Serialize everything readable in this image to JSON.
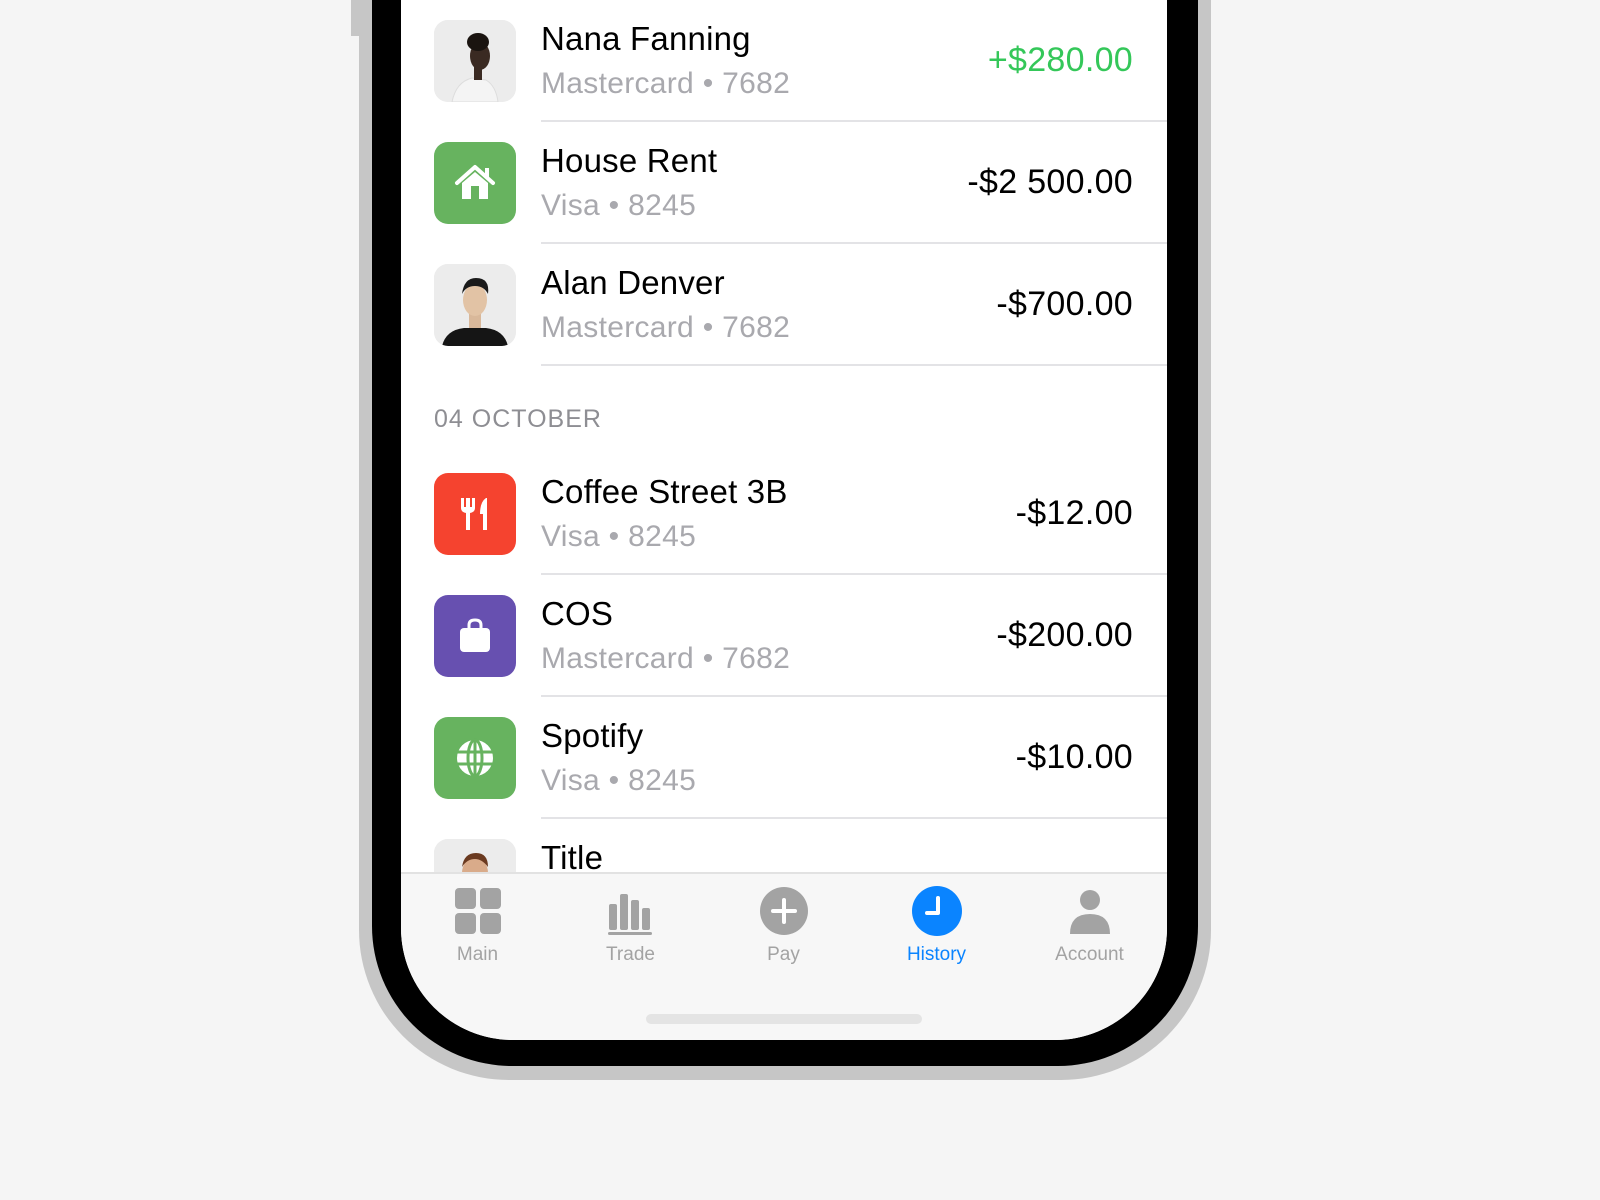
{
  "transactions_top": [
    {
      "name": "Nana Fanning",
      "card": "Mastercard",
      "last4": "7682",
      "amount": "+$280.00",
      "type": "income",
      "icon": "avatar-photo"
    },
    {
      "name": "House Rent",
      "card": "Visa",
      "last4": "8245",
      "amount": "-$2 500.00",
      "type": "expense",
      "icon": "house-icon",
      "icon_color": "#67b35f"
    },
    {
      "name": "Alan Denver",
      "card": "Mastercard",
      "last4": "7682",
      "amount": "-$700.00",
      "type": "expense",
      "icon": "avatar-photo"
    }
  ],
  "section_header": "04 OCTOBER",
  "transactions_bottom": [
    {
      "name": "Coffee Street 3B",
      "card": "Visa",
      "last4": "8245",
      "amount": "-$12.00",
      "type": "expense",
      "icon": "fork-knife-icon",
      "icon_color": "#f5432f"
    },
    {
      "name": "COS",
      "card": "Mastercard",
      "last4": "7682",
      "amount": "-$200.00",
      "type": "expense",
      "icon": "shopping-bag-icon",
      "icon_color": "#6750b0"
    },
    {
      "name": "Spotify",
      "card": "Visa",
      "last4": "8245",
      "amount": "-$10.00",
      "type": "expense",
      "icon": "globe-icon",
      "icon_color": "#67b35f"
    },
    {
      "name": "Title",
      "icon": "avatar-photo"
    }
  ],
  "separator": "•",
  "tabbar": {
    "items": [
      {
        "label": "Main",
        "icon": "grid-icon"
      },
      {
        "label": "Trade",
        "icon": "bar-chart-icon"
      },
      {
        "label": "Pay",
        "icon": "plus-circle-icon"
      },
      {
        "label": "History",
        "icon": "clock-icon",
        "active": true
      },
      {
        "label": "Account",
        "icon": "person-icon"
      }
    ]
  },
  "colors": {
    "accent": "#0a84ff",
    "income": "#34c759",
    "inactive_tab": "#a3a3a3"
  }
}
